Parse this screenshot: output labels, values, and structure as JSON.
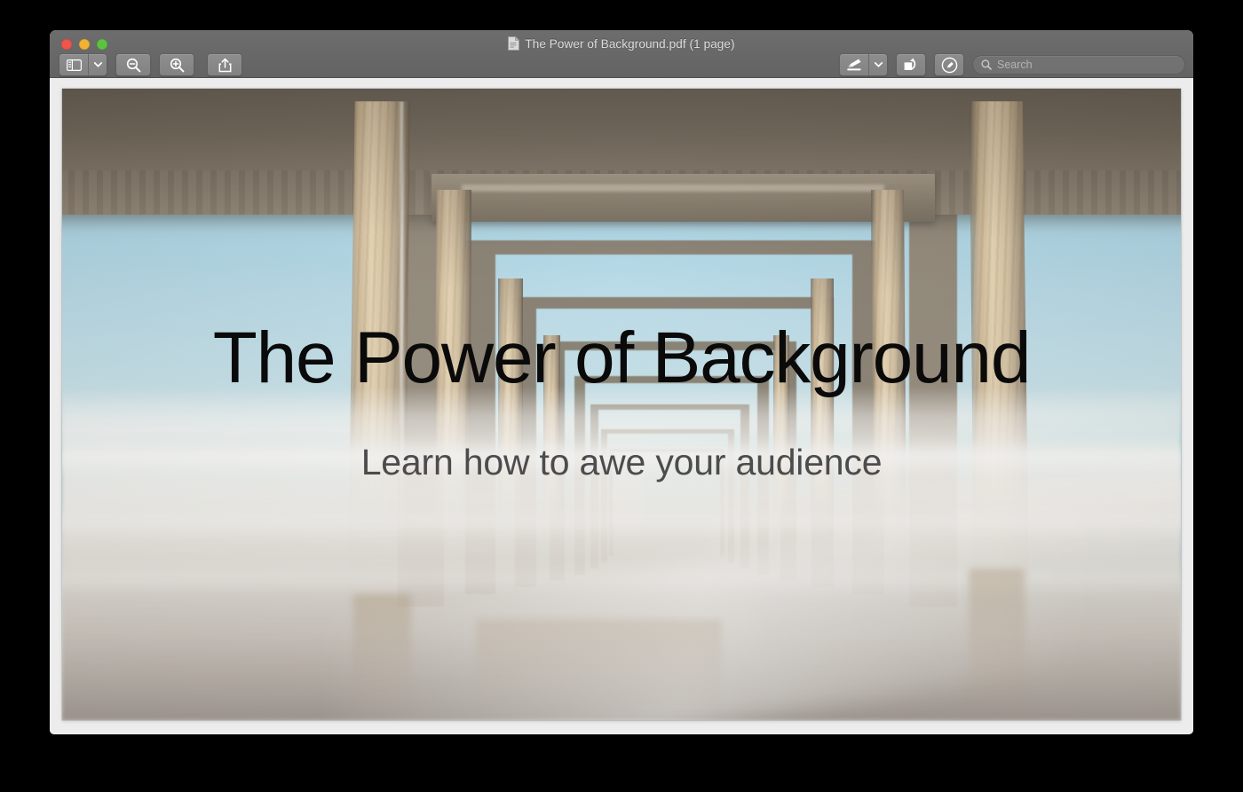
{
  "window": {
    "title": "The Power of Background.pdf (1 page)",
    "title_icon": "pdf-document-icon",
    "traffic_lights": [
      {
        "name": "close",
        "label": "Close",
        "color": "#f1544b"
      },
      {
        "name": "minimize",
        "label": "Minimize",
        "color": "#f0b231"
      },
      {
        "name": "maximize",
        "label": "Zoom",
        "color": "#5bc43f"
      }
    ],
    "titlebar_color": "#686868",
    "content_bg": "#ececec"
  },
  "toolbar": {
    "left": [
      {
        "name": "sidebar-toggle",
        "label": "Sidebar",
        "icon": "sidebar-icon",
        "has_menu": true
      },
      {
        "name": "zoom-out",
        "label": "Zoom Out",
        "icon": "magnifier-minus-icon"
      },
      {
        "name": "zoom-in",
        "label": "Zoom In",
        "icon": "magnifier-plus-icon"
      },
      {
        "name": "share",
        "label": "Share",
        "icon": "share-icon"
      }
    ],
    "right": [
      {
        "name": "markup-pen",
        "label": "Markup",
        "icon": "pen-icon",
        "has_menu": true
      },
      {
        "name": "rotate-left",
        "label": "Rotate",
        "icon": "rotate-left-icon"
      },
      {
        "name": "annotate",
        "label": "Annotate",
        "icon": "circled-pen-icon"
      }
    ]
  },
  "search": {
    "placeholder": "Search",
    "value": "",
    "icon": "search-icon"
  },
  "slide": {
    "title": "The Power of Background",
    "subtitle": "Learn how to awe your audience",
    "title_color": "#0a0a0a",
    "subtitle_color": "#4c4c4c",
    "background_description": "Long-exposure photograph looking along the underside of a concrete pier; receding arches, blue sky at left and right, turquoise ocean and misty white water",
    "palette": {
      "sky": "#a3d0e2",
      "ocean": "#68becd",
      "concrete": "#e2cda8",
      "deck_shadow": "#4a4238",
      "mist": "#f6f4f0"
    }
  },
  "page_info": {
    "page_count": "1 page",
    "document_name": "The Power of Background.pdf"
  }
}
